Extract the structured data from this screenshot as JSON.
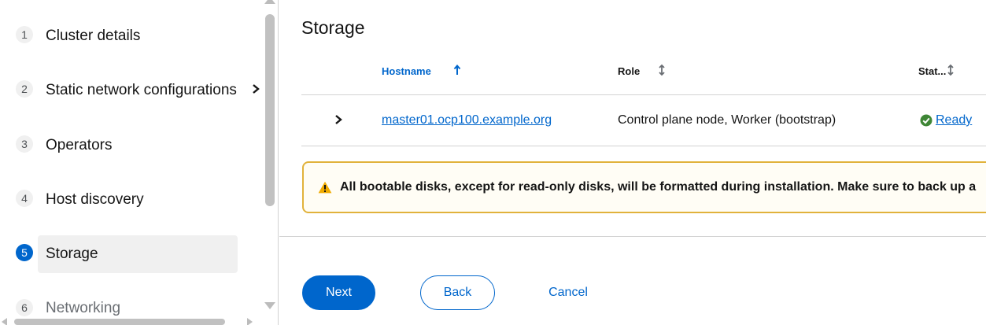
{
  "nav": {
    "steps": [
      {
        "number": "1",
        "label": "Cluster details"
      },
      {
        "number": "2",
        "label": "Static network configurations"
      },
      {
        "number": "3",
        "label": "Operators"
      },
      {
        "number": "4",
        "label": "Host discovery"
      },
      {
        "number": "5",
        "label": "Storage"
      },
      {
        "number": "6",
        "label": "Networking"
      }
    ],
    "current_step": "5",
    "icons": {
      "expand_step": "chevron-right-icon"
    }
  },
  "main": {
    "title": "Storage",
    "table": {
      "headers": {
        "hostname": "Hostname",
        "role": "Role",
        "status": "Stat..."
      },
      "rows": [
        {
          "hostname": "master01.ocp100.example.org",
          "role": "Control plane node, Worker (bootstrap)",
          "status": "Ready"
        }
      ]
    },
    "alert": {
      "text": "All bootable disks, except for read-only disks, will be formatted during installation. Make sure to back up a"
    },
    "buttons": {
      "next": "Next",
      "back": "Back",
      "cancel": "Cancel"
    }
  },
  "colors": {
    "primary": "#0066cc",
    "success": "#3e8635",
    "warning": "#f0ab00",
    "warning_border": "#e1b23b"
  }
}
